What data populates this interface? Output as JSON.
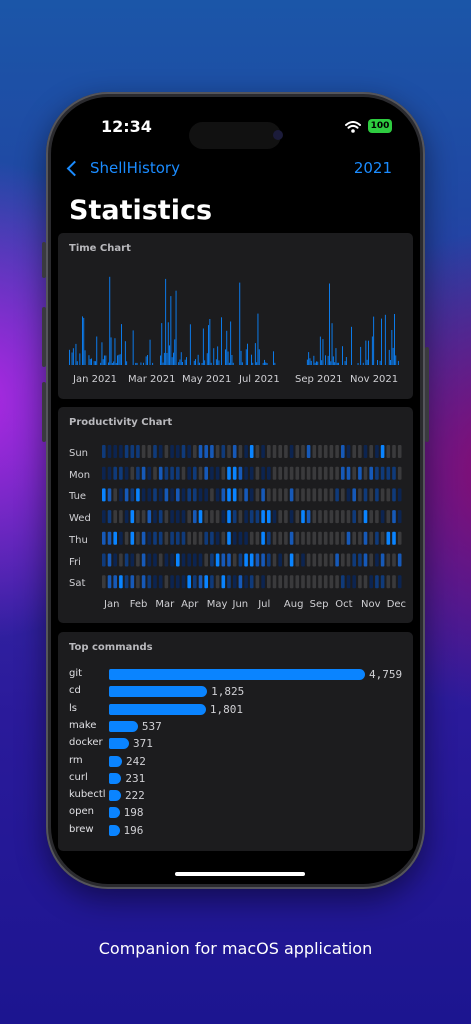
{
  "status_bar": {
    "time": "12:34",
    "battery": "100"
  },
  "nav": {
    "back_label": "ShellHistory",
    "year": "2021"
  },
  "page_title": "Statistics",
  "time_chart": {
    "title": "Time Chart",
    "x_labels": [
      "Jan 2021",
      "Mar 2021",
      "May 2021",
      "Jul 2021",
      "Sep 2021",
      "Nov 2021"
    ]
  },
  "productivity_chart": {
    "title": "Productivity Chart",
    "days": [
      "Sun",
      "Mon",
      "Tue",
      "Wed",
      "Thu",
      "Fri",
      "Sat"
    ],
    "months": [
      "Jan",
      "Feb",
      "Mar",
      "Apr",
      "May",
      "Jun",
      "Jul",
      "Aug",
      "Sep",
      "Oct",
      "Nov",
      "Dec"
    ]
  },
  "top_commands": {
    "title": "Top commands",
    "items": [
      {
        "name": "git",
        "count": "4,759"
      },
      {
        "name": "cd",
        "count": "1,825"
      },
      {
        "name": "ls",
        "count": "1,801"
      },
      {
        "name": "make",
        "count": "537"
      },
      {
        "name": "docker",
        "count": "371"
      },
      {
        "name": "rm",
        "count": "242"
      },
      {
        "name": "curl",
        "count": "231"
      },
      {
        "name": "kubectl",
        "count": "222"
      },
      {
        "name": "open",
        "count": "198"
      },
      {
        "name": "brew",
        "count": "196"
      }
    ]
  },
  "caption": "Companion for macOS application",
  "colors": {
    "accent": "#0a84ff",
    "card": "#1c1c1e",
    "inactive_cell": "#3a3a3c"
  }
}
